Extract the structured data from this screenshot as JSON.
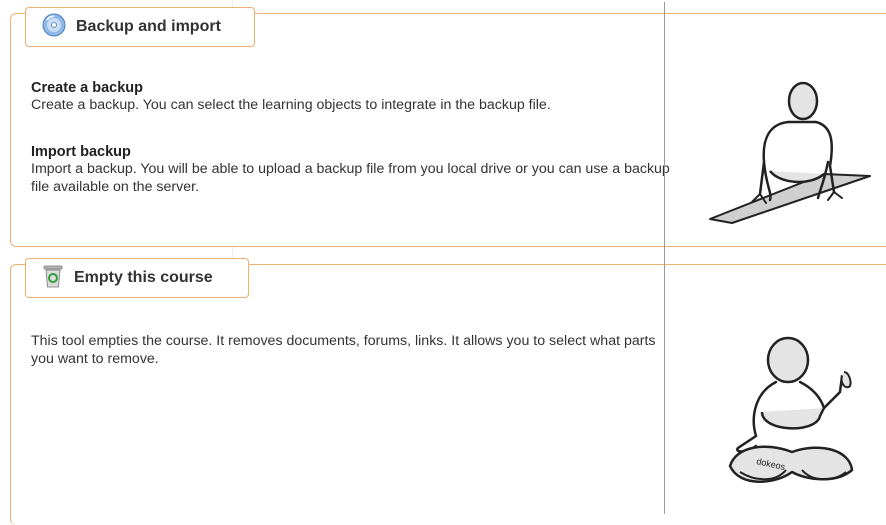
{
  "sections": [
    {
      "title": "Backup and import",
      "icon": "cd-backup-icon",
      "items": [
        {
          "title": "Create a backup",
          "description": "Create a backup. You can select the learning objects to integrate in the backup file."
        },
        {
          "title": "Import backup",
          "description": "Import a backup. You will be able to upload a backup file from you local drive or you can use a backup file available on the server."
        }
      ]
    },
    {
      "title": "Empty this course",
      "icon": "recycle-bin-icon",
      "description": "This tool empties the course. It removes documents, forums, links. It allows you to select what parts you want to remove.",
      "figure_caption": "dokeos"
    }
  ],
  "colors": {
    "border": "#f0b070",
    "text": "#333333",
    "divider": "#9a9a9a"
  }
}
